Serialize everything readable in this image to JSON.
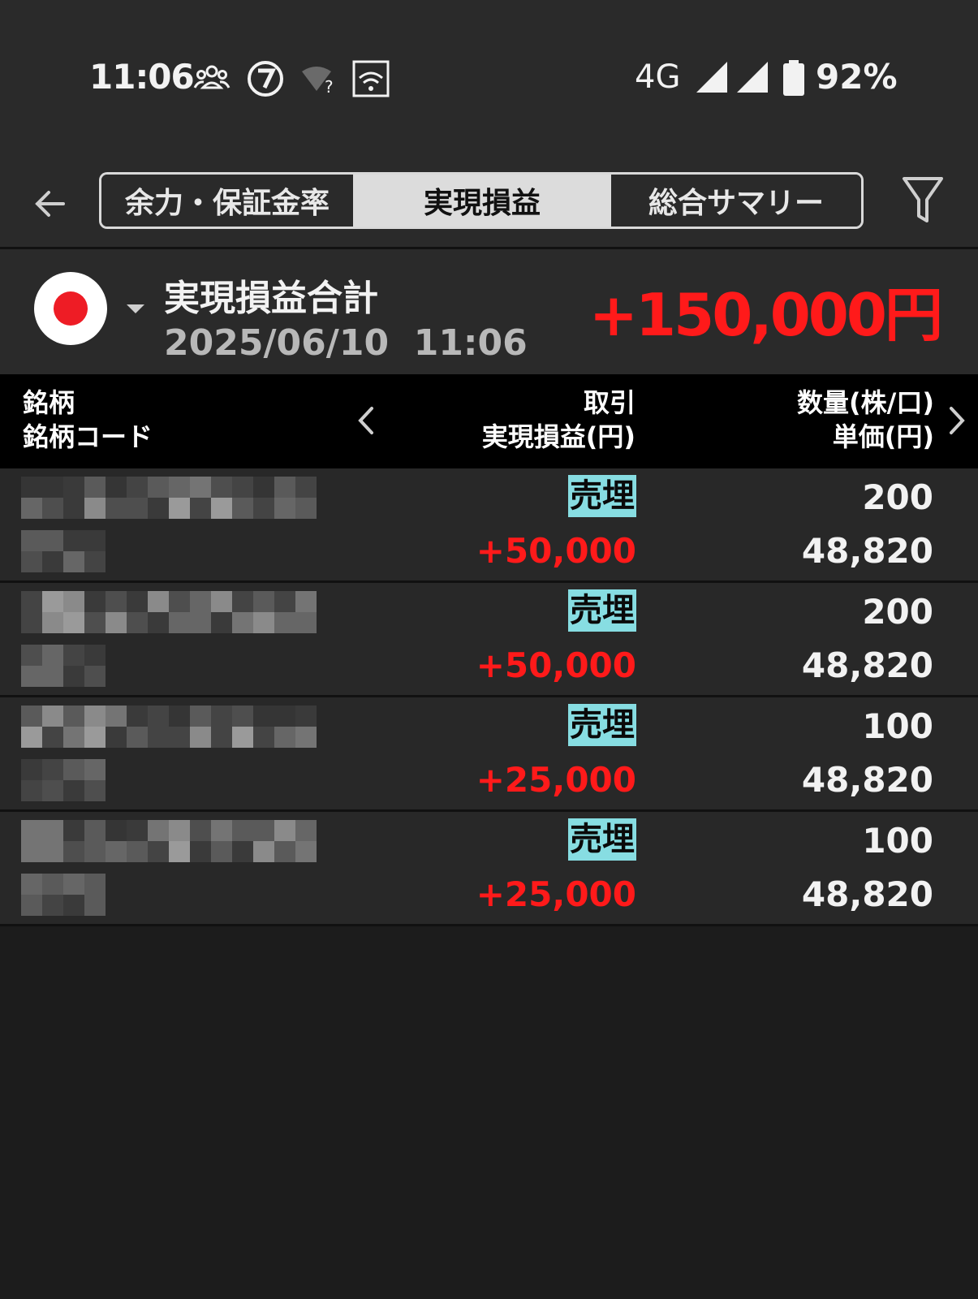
{
  "status_bar": {
    "time": "11:06",
    "network": "4G",
    "battery": "92%",
    "icons": [
      "people-icon",
      "seven-eleven-icon",
      "wifi-unknown-icon",
      "au-wifi-icon",
      "signal-icon",
      "signal-icon",
      "battery-icon"
    ]
  },
  "toolbar": {
    "back_icon": "back-arrow-icon",
    "tabs": [
      {
        "label": "余力・保証金率",
        "active": false
      },
      {
        "label": "実現損益",
        "active": true
      },
      {
        "label": "総合サマリー",
        "active": false
      }
    ],
    "filter_icon": "filter-icon"
  },
  "summary": {
    "title": "実現損益合計",
    "datetime": "2025/06/10  11:06",
    "total": "+150,000円"
  },
  "table": {
    "headers": {
      "col1_line1": "銘柄",
      "col1_line2": "銘柄コード",
      "col2_line1": "取引",
      "col2_line2": "実現損益(円)",
      "col3_line1": "数量(株/口)",
      "col3_line2": "単価(円)"
    },
    "rows": [
      {
        "trade": "売埋",
        "pnl": "+50,000",
        "quantity": "200",
        "price": "48,820"
      },
      {
        "trade": "売埋",
        "pnl": "+50,000",
        "quantity": "200",
        "price": "48,820"
      },
      {
        "trade": "売埋",
        "pnl": "+25,000",
        "quantity": "100",
        "price": "48,820"
      },
      {
        "trade": "売埋",
        "pnl": "+25,000",
        "quantity": "100",
        "price": "48,820"
      }
    ]
  },
  "colors": {
    "background": "#1c1c1c",
    "bar": "#2a2a2a",
    "profit": "#ff1a1a",
    "badge": "#87dde2",
    "active_tab": "#dcdcdc"
  }
}
